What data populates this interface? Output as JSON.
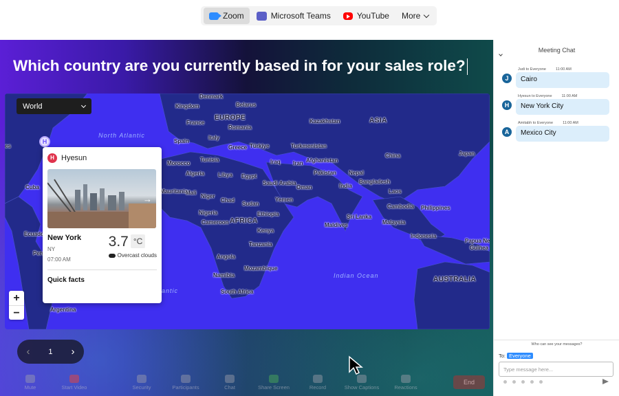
{
  "tabs": [
    {
      "label": "Zoom",
      "icon": "zoom-icon"
    },
    {
      "label": "Microsoft Teams",
      "icon": "teams-icon"
    },
    {
      "label": "YouTube",
      "icon": "youtube-icon"
    },
    {
      "label": "More",
      "icon": "chevron-down-icon"
    }
  ],
  "stage": {
    "question": "Which country are you currently based in for your sales role?",
    "map_select": "World",
    "zoom_in": "+",
    "zoom_out": "−",
    "pin_letter": "H",
    "map_labels": {
      "denmark": "Denmark",
      "kingdom": "Kingdom",
      "belarus": "Belarus",
      "europe": "EUROPE",
      "france": "France",
      "romania": "Romania",
      "kazakhstan": "Kazakhstan",
      "asia": "ASIA",
      "italy": "Italy",
      "spain": "Spain",
      "greece": "Greece",
      "turkiye": "Türkiye",
      "turkmenistan": "Turkmenistan",
      "china": "China",
      "japan": "Japan",
      "morocco": "Morocco",
      "tunisia": "Tunisia",
      "iraq": "Iraq",
      "iran": "Iran",
      "afghanistan": "Afghanistan",
      "algeria": "Algeria",
      "libya": "Libya",
      "egypt": "Egypt",
      "pakistan": "Pakistan",
      "nepal": "Nepal",
      "bangladesh": "Bangladesh",
      "saudi_arabia": "Saudi Arabia",
      "india": "India",
      "oman": "Oman",
      "laos": "Laos",
      "mauritania": "Mauritania",
      "mali": "Mali",
      "niger": "Niger",
      "chad": "Chad",
      "sudan": "Sudan",
      "yemen": "Yemen",
      "cambodia": "Cambodia",
      "philippines": "Philippines",
      "nigeria": "Nigeria",
      "ethiopia": "Ethiopia",
      "sri_lanka": "Sri Lanka",
      "cameroon": "Cameroon",
      "africa": "AFRICA",
      "maldives": "Maldives",
      "malaysia": "Malaysia",
      "kenya": "Kenya",
      "tanzania": "Tanzania",
      "indonesia": "Indonesia",
      "papua": "Papua New",
      "guinea": "Guinea",
      "angola": "Angola",
      "mozambique": "Mozambique",
      "namibia": "Namibia",
      "australia": "AUSTRALIA",
      "south_africa": "South Africa",
      "cuba": "Cuba",
      "ecuador": "Ecuador",
      "peru": "Peru",
      "argentina": "Argentina",
      "es": "es",
      "north_atlantic": "North Atlantic",
      "indian_ocean": "Indian Ocean",
      "antic": "antic"
    },
    "weather_card": {
      "user": "Hyesun",
      "user_initial": "H",
      "city": "New York",
      "state": "NY",
      "time": "07:00 AM",
      "temperature": "3.7",
      "unit": "°C",
      "condition": "Overcast clouds",
      "quick_facts": "Quick facts"
    },
    "pager": {
      "page": "1"
    }
  },
  "toolbar": [
    {
      "label": "Mute",
      "icon": "microphone-icon"
    },
    {
      "label": "Start Video",
      "icon": "video-off-icon"
    },
    {
      "label": "Security",
      "icon": "shield-icon"
    },
    {
      "label": "Participants",
      "icon": "participants-icon"
    },
    {
      "label": "Chat",
      "icon": "chat-icon"
    },
    {
      "label": "Share Screen",
      "icon": "share-screen-icon"
    },
    {
      "label": "Record",
      "icon": "record-icon"
    },
    {
      "label": "Show Captions",
      "icon": "captions-icon"
    },
    {
      "label": "Reactions",
      "icon": "reactions-icon"
    },
    {
      "label": "End",
      "icon": "end-icon"
    }
  ],
  "chat": {
    "title": "Meeting Chat",
    "messages": [
      {
        "initial": "J",
        "sender": "Judi to Everyone",
        "time": "11:00 AM",
        "text": "Cairo"
      },
      {
        "initial": "H",
        "sender": "Hyesun to Everyone",
        "time": "11:00 AM",
        "text": "New York City"
      },
      {
        "initial": "A",
        "sender": "Amitabh to Everyone",
        "time": "11:00 AM",
        "text": "Mexico City"
      }
    ],
    "who_can_see": "Who can see your messages?",
    "to_label": "To:",
    "to_value": "Everyone",
    "placeholder": "Type message here..."
  },
  "colors": {
    "map_land": "#222a8a",
    "map_ocean": "#3f2ff0",
    "zoom_blue": "#2d8cff",
    "chat_bubble": "#dceefb",
    "avatar_blue": "#19659a"
  }
}
